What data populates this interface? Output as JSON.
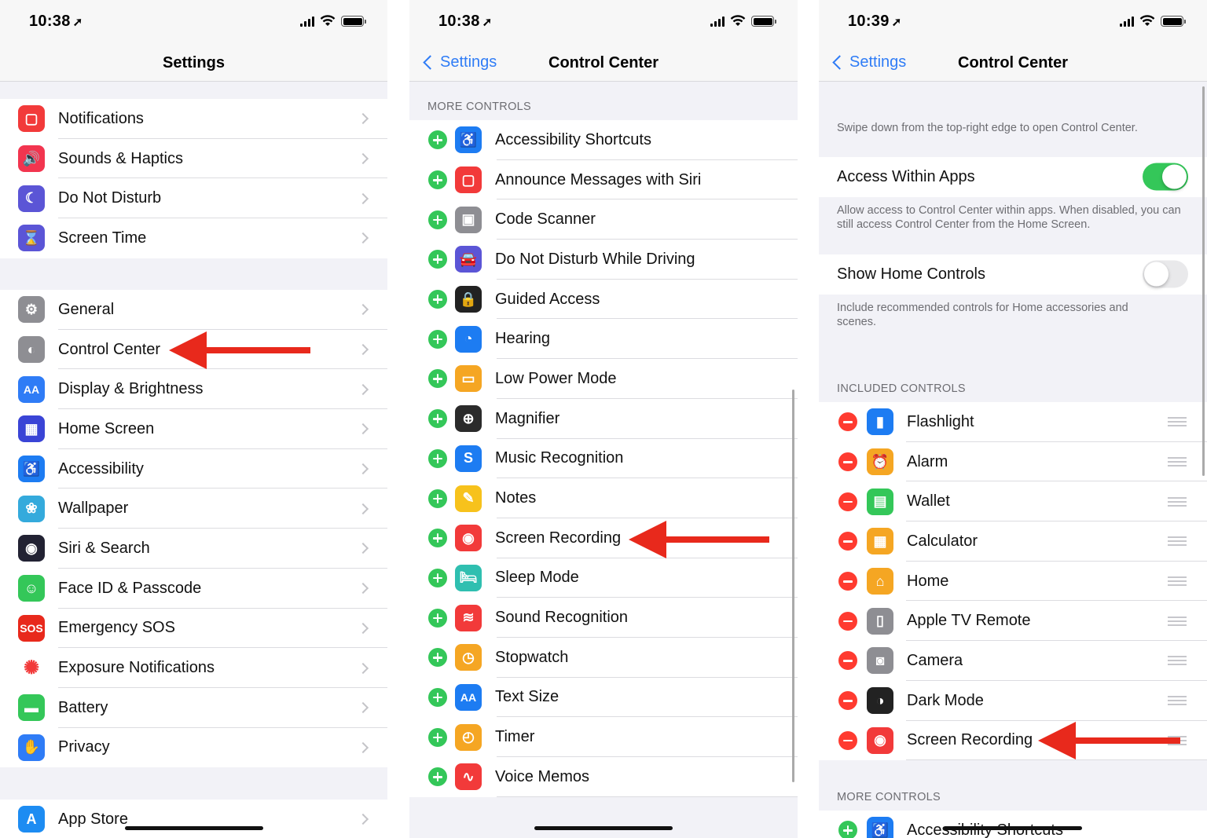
{
  "colors": {
    "accent": "#2f7cf6",
    "add": "#34c759",
    "remove": "#ff3b30",
    "annotation_arrow": "#e8291c"
  },
  "p1": {
    "time": "10:38",
    "title": "Settings",
    "group1": [
      {
        "label": "Notifications",
        "icon": "notifications-icon",
        "color": "#f23a3a"
      },
      {
        "label": "Sounds & Haptics",
        "icon": "speaker-icon",
        "color": "#f2354f"
      },
      {
        "label": "Do Not Disturb",
        "icon": "moon-icon",
        "color": "#5b55d6"
      },
      {
        "label": "Screen Time",
        "icon": "hourglass-icon",
        "color": "#5b55d6"
      }
    ],
    "group2": [
      {
        "label": "General",
        "icon": "gear-icon",
        "color": "#8e8e93"
      },
      {
        "label": "Control Center",
        "icon": "toggles-icon",
        "color": "#8e8e93"
      },
      {
        "label": "Display & Brightness",
        "icon": "text-size-icon",
        "color": "#2f7cf6"
      },
      {
        "label": "Home Screen",
        "icon": "app-grid-icon",
        "color": "#3a44d6"
      },
      {
        "label": "Accessibility",
        "icon": "accessibility-icon",
        "color": "#1d7cf2"
      },
      {
        "label": "Wallpaper",
        "icon": "flower-icon",
        "color": "#34aadc"
      },
      {
        "label": "Siri & Search",
        "icon": "siri-icon",
        "color": "#222233"
      },
      {
        "label": "Face ID & Passcode",
        "icon": "face-id-icon",
        "color": "#34c759"
      },
      {
        "label": "Emergency SOS",
        "icon": "sos-icon",
        "color": "#e8291c"
      },
      {
        "label": "Exposure Notifications",
        "icon": "exposure-icon",
        "color": "#ffffff"
      },
      {
        "label": "Battery",
        "icon": "battery-icon",
        "color": "#34c759"
      },
      {
        "label": "Privacy",
        "icon": "hand-icon",
        "color": "#2f7cf6"
      }
    ],
    "group3": [
      {
        "label": "App Store",
        "icon": "app-store-icon",
        "color": "#1d8cf2"
      }
    ]
  },
  "p2": {
    "time": "10:38",
    "back": "Settings",
    "title": "Control Center",
    "section": "MORE CONTROLS",
    "items": [
      {
        "label": "Accessibility Shortcuts",
        "icon": "accessibility-icon",
        "color": "#1d7cf2"
      },
      {
        "label": "Announce Messages with Siri",
        "icon": "announce-icon",
        "color": "#f23a3a"
      },
      {
        "label": "Code Scanner",
        "icon": "qr-code-icon",
        "color": "#8e8e93"
      },
      {
        "label": "Do Not Disturb While Driving",
        "icon": "car-icon",
        "color": "#5b55d6"
      },
      {
        "label": "Guided Access",
        "icon": "lock-icon",
        "color": "#222222"
      },
      {
        "label": "Hearing",
        "icon": "ear-icon",
        "color": "#1d7cf2"
      },
      {
        "label": "Low Power Mode",
        "icon": "low-power-icon",
        "color": "#f5a623"
      },
      {
        "label": "Magnifier",
        "icon": "magnifier-icon",
        "color": "#2b2b2b"
      },
      {
        "label": "Music Recognition",
        "icon": "shazam-icon",
        "color": "#1d7cf2"
      },
      {
        "label": "Notes",
        "icon": "notes-icon",
        "color": "#f7c21c"
      },
      {
        "label": "Screen Recording",
        "icon": "record-icon",
        "color": "#f23a3a"
      },
      {
        "label": "Sleep Mode",
        "icon": "bed-icon",
        "color": "#2fbfb0"
      },
      {
        "label": "Sound Recognition",
        "icon": "sound-recognition-icon",
        "color": "#f23a3a"
      },
      {
        "label": "Stopwatch",
        "icon": "stopwatch-icon",
        "color": "#f5a623"
      },
      {
        "label": "Text Size",
        "icon": "text-size-icon",
        "color": "#1d7cf2"
      },
      {
        "label": "Timer",
        "icon": "timer-icon",
        "color": "#f5a623"
      },
      {
        "label": "Voice Memos",
        "icon": "waveform-icon",
        "color": "#f23a3a"
      }
    ]
  },
  "p3": {
    "time": "10:39",
    "back": "Settings",
    "title": "Control Center",
    "intro": "Swipe down from the top-right edge to open Control Center.",
    "access_label": "Access Within Apps",
    "access_on": true,
    "access_foot": "Allow access to Control Center within apps. When disabled, you can still access Control Center from the Home Screen.",
    "home_label": "Show Home Controls",
    "home_on": false,
    "home_foot": "Include recommended controls for Home accessories and scenes.",
    "included_header": "INCLUDED CONTROLS",
    "included": [
      {
        "label": "Flashlight",
        "icon": "flashlight-icon",
        "color": "#1d7cf2"
      },
      {
        "label": "Alarm",
        "icon": "alarm-icon",
        "color": "#f5a623"
      },
      {
        "label": "Wallet",
        "icon": "wallet-icon",
        "color": "#34c759"
      },
      {
        "label": "Calculator",
        "icon": "calculator-icon",
        "color": "#f5a623"
      },
      {
        "label": "Home",
        "icon": "home-icon",
        "color": "#f5a623"
      },
      {
        "label": "Apple TV Remote",
        "icon": "remote-icon",
        "color": "#8e8e93"
      },
      {
        "label": "Camera",
        "icon": "camera-icon",
        "color": "#8e8e93"
      },
      {
        "label": "Dark Mode",
        "icon": "dark-mode-icon",
        "color": "#222222"
      },
      {
        "label": "Screen Recording",
        "icon": "record-icon",
        "color": "#f23a3a"
      }
    ],
    "more_header": "MORE CONTROLS",
    "more": [
      {
        "label": "Accessibility Shortcuts",
        "icon": "accessibility-icon",
        "color": "#1d7cf2"
      }
    ]
  }
}
